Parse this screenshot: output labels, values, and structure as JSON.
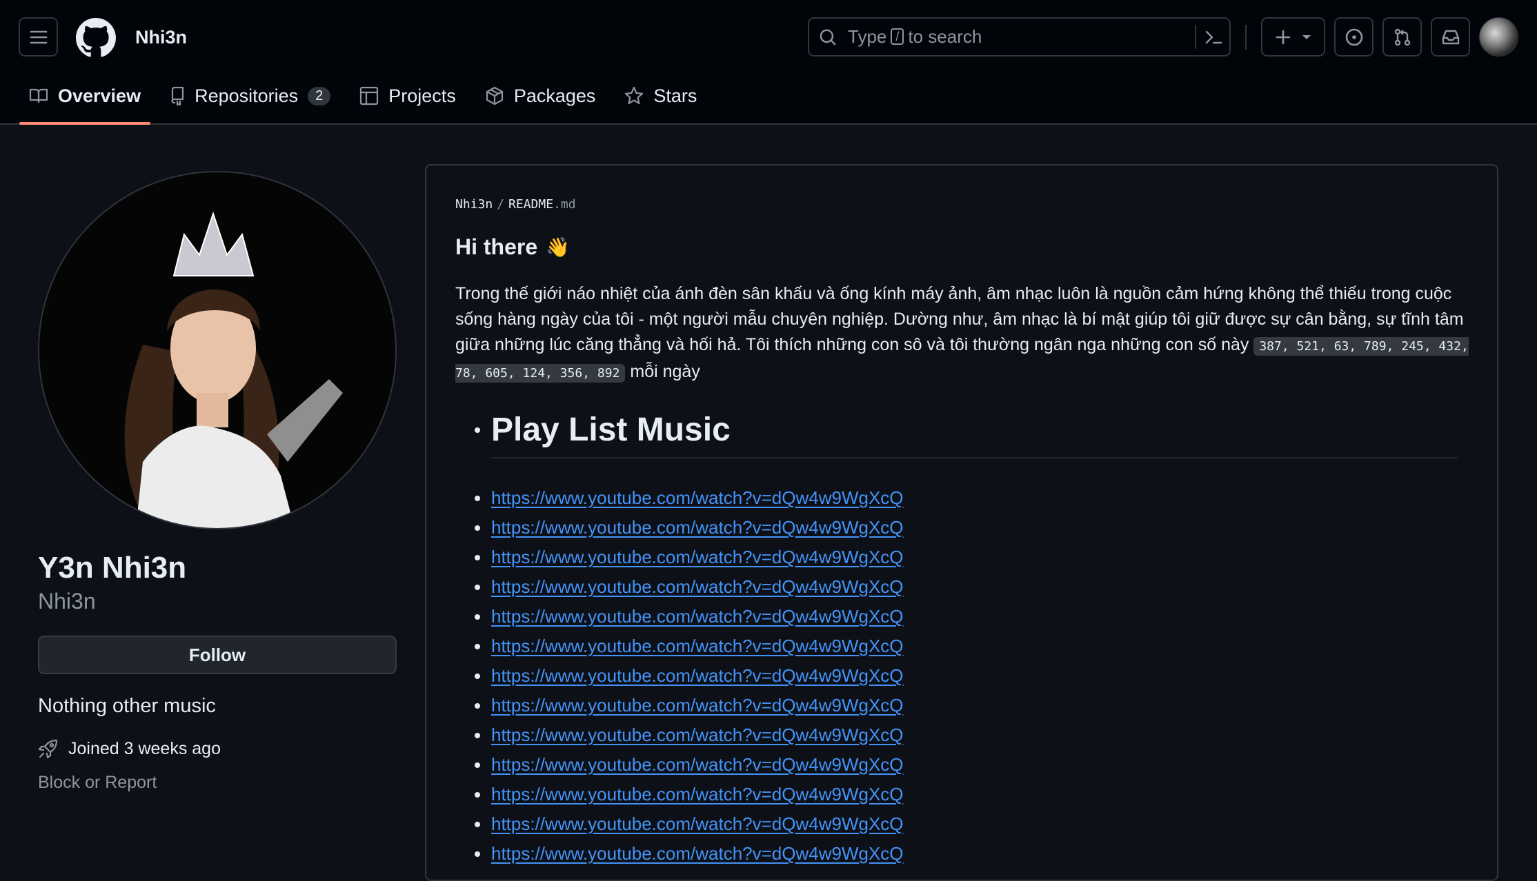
{
  "header": {
    "username": "Nhi3n",
    "search": {
      "prefix": "Type",
      "key": "/",
      "suffix": "to search"
    }
  },
  "tabs": [
    {
      "label": "Overview",
      "icon": "book-icon",
      "active": true
    },
    {
      "label": "Repositories",
      "icon": "repo-icon",
      "count": "2"
    },
    {
      "label": "Projects",
      "icon": "table-icon"
    },
    {
      "label": "Packages",
      "icon": "package-icon"
    },
    {
      "label": "Stars",
      "icon": "star-icon"
    }
  ],
  "profile": {
    "full_name": "Y3n Nhi3n",
    "login": "Nhi3n",
    "follow_label": "Follow",
    "bio": "Nothing other music",
    "joined": "Joined 3 weeks ago",
    "block_report": "Block or Report"
  },
  "readme": {
    "owner": "Nhi3n",
    "file_name": "README",
    "file_ext": ".md",
    "heading": "Hi there",
    "wave": "👋",
    "paragraph_text": "Trong thế giới náo nhiệt của ánh đèn sân khấu và ống kính máy ảnh, âm nhạc luôn là nguồn cảm hứng không thể thiếu trong cuộc sống hàng ngày của tôi - một người mẫu chuyên nghiệp. Dường như, âm nhạc là bí mật giúp tôi giữ được sự cân bằng, sự tĩnh tâm giữa những lúc căng thẳng và hối hả. Tôi thích những con sô và tôi thường ngân nga những con số này",
    "paragraph_code": "387, 521, 63, 789, 245, 432, 78, 605, 124, 356, 892",
    "paragraph_end": "mỗi ngày",
    "playlist_title": "Play List Music",
    "links": [
      "https://www.youtube.com/watch?v=dQw4w9WgXcQ",
      "https://www.youtube.com/watch?v=dQw4w9WgXcQ",
      "https://www.youtube.com/watch?v=dQw4w9WgXcQ",
      "https://www.youtube.com/watch?v=dQw4w9WgXcQ",
      "https://www.youtube.com/watch?v=dQw4w9WgXcQ",
      "https://www.youtube.com/watch?v=dQw4w9WgXcQ",
      "https://www.youtube.com/watch?v=dQw4w9WgXcQ",
      "https://www.youtube.com/watch?v=dQw4w9WgXcQ",
      "https://www.youtube.com/watch?v=dQw4w9WgXcQ",
      "https://www.youtube.com/watch?v=dQw4w9WgXcQ",
      "https://www.youtube.com/watch?v=dQw4w9WgXcQ",
      "https://www.youtube.com/watch?v=dQw4w9WgXcQ",
      "https://www.youtube.com/watch?v=dQw4w9WgXcQ"
    ]
  },
  "colors": {
    "background": "#0d1117",
    "header_bg": "#010409",
    "border": "#30363d",
    "link": "#4493f8",
    "active_tab": "#fd8c73",
    "muted_text": "#8d96a0"
  }
}
